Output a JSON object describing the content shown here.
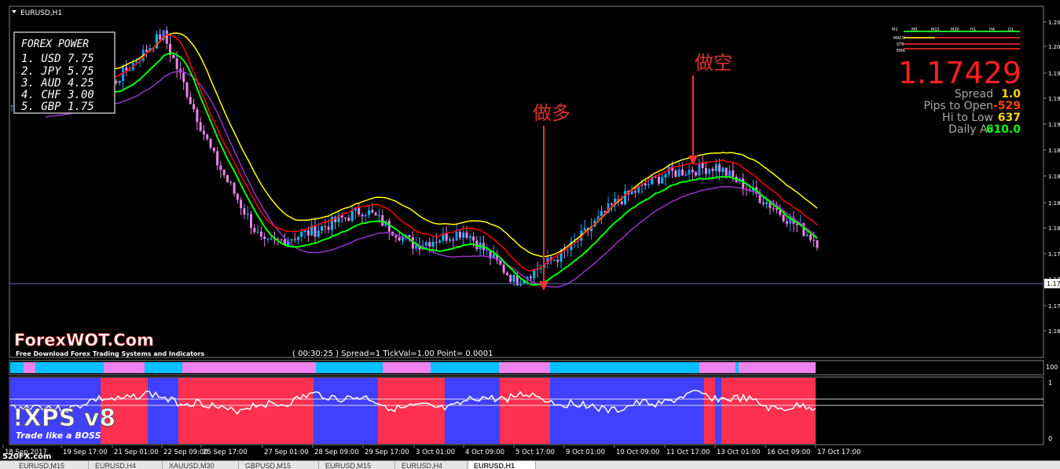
{
  "window": {
    "symbol_title": "EURUSD,H1"
  },
  "forex_power": {
    "title": "FOREX  POWER",
    "items": [
      "1. USD  7.75",
      "2. JPY  5.75",
      "3. AUD  4.25",
      "4. CHF  3.00",
      "5. GBP  1.75"
    ]
  },
  "annotations": {
    "long": "做多",
    "short": "做空"
  },
  "price_panel": {
    "price": "1.17429",
    "rows": [
      {
        "label": "Spread",
        "value": "1.0",
        "color": "#ffd700"
      },
      {
        "label": "Pips to Open",
        "value": "-529",
        "color": "#ff4500"
      },
      {
        "label": "Hi to Low",
        "value": "637",
        "color": "#ffd700"
      },
      {
        "label": "Daily Av",
        "value": "610.0",
        "color": "#00ff00"
      }
    ],
    "tf_labels": [
      "M1",
      "M5",
      "M15",
      "M30",
      "H1",
      "H4",
      "D1"
    ],
    "ind_labels": [
      "MACD",
      "STR",
      "EMA"
    ]
  },
  "branding": {
    "logo": "ForexWOT.Com",
    "tagline": "Free Download Forex Trading Systems and Indicators",
    "xps_logo": "!XPS v8",
    "xps_tagline": "Trade like a BOSS",
    "watermark": "520FX.com"
  },
  "status_line": "( 00:30:25 )  Spread=1  TickVal=1.00  Point= 0.0001",
  "price_axis": [
    "1.20",
    "1.20",
    "1.19",
    "1.19",
    "1.19",
    "1.18",
    "1.18",
    "1.18",
    "1.18",
    "1.17",
    "1.17",
    "1.17",
    "1.16"
  ],
  "current_price_tag": "1.17",
  "indicator_axis": [
    "100"
  ],
  "osc_axis": [
    "1",
    "0"
  ],
  "time_axis": [
    "18 Sep 2017",
    "19 Sep 17:00",
    "21 Sep 01:00",
    "22 Sep 09:00",
    "25 Sep 17:00",
    "27 Sep 01:00",
    "28 Sep 09:00",
    "29 Sep 17:00",
    "3 Oct 01:00",
    "4 Oct 09:00",
    "5 Oct 17:00",
    "9 Oct 01:00",
    "10 Oct 09:00",
    "11 Oct 17:00",
    "13 Oct 01:00",
    "16 Oct 09:00",
    "17 Oct 17:00"
  ],
  "tabs": [
    "EURUSD,M15",
    "EURUSD,H4",
    "XAUUSD,M30",
    "GBPUSD,M15",
    "EURUSD,M15",
    "EURUSD,H4",
    "EURUSD,H1"
  ],
  "colors": {
    "bull": "#1e90ff",
    "bull_light": "#00bfff",
    "bear": "#ee82ee",
    "ma_fast": "#ff0000",
    "ma_slow": "#ffff00",
    "signal": "#00ff00",
    "trail": "#9932cc",
    "osc_up": "#4040ff",
    "osc_down": "#ff3050"
  },
  "chart_data": {
    "type": "line",
    "x": [
      "18 Sep 2017",
      "19 Sep 17:00",
      "21 Sep 01:00",
      "22 Sep 09:00",
      "25 Sep 17:00",
      "27 Sep 01:00",
      "28 Sep 09:00",
      "29 Sep 17:00",
      "3 Oct 01:00",
      "4 Oct 09:00",
      "5 Oct 17:00",
      "9 Oct 01:00",
      "10 Oct 09:00",
      "11 Oct 17:00",
      "13 Oct 01:00",
      "16 Oct 09:00",
      "17 Oct 17:00"
    ],
    "series": [
      {
        "values": [
          1.1935,
          1.1955,
          1.1965,
          1.2035,
          1.1865,
          1.174,
          1.176,
          1.179,
          1.174,
          1.176,
          1.169,
          1.173,
          1.18,
          1.184,
          1.185,
          1.18,
          1.1745
        ]
      }
    ],
    "ylim": [
      1.16,
      1.206
    ]
  }
}
